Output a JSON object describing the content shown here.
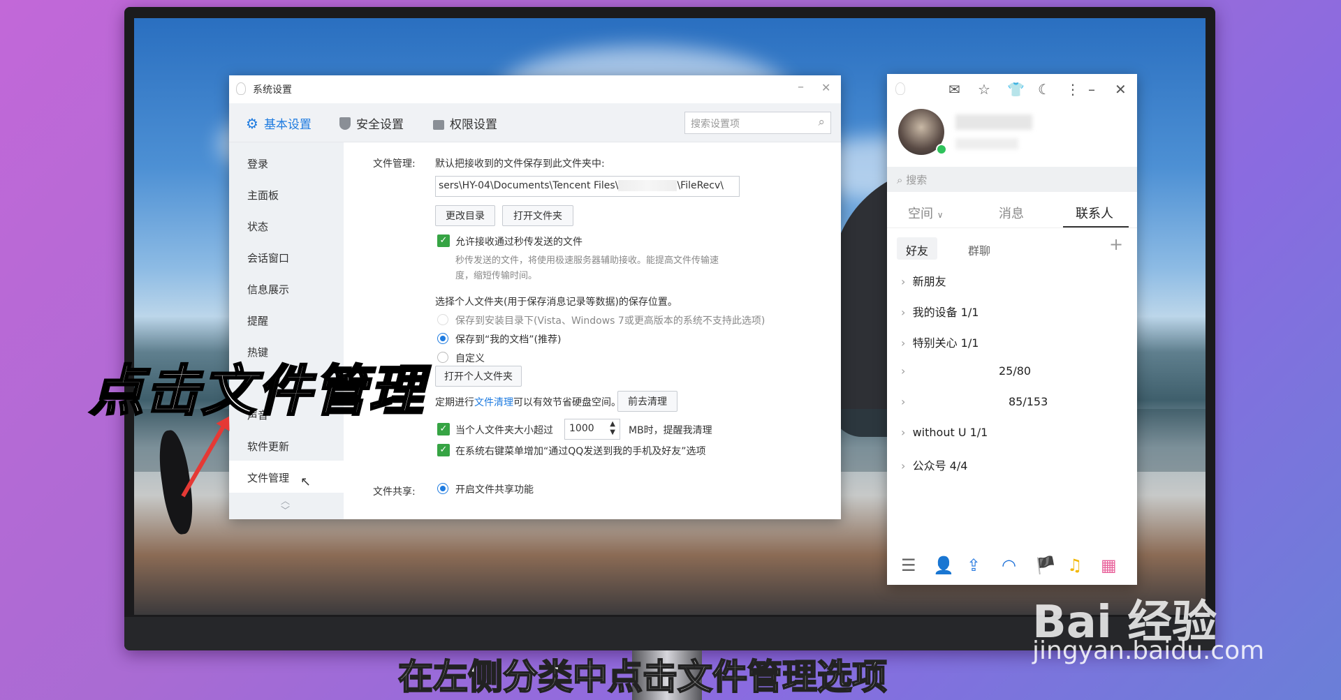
{
  "settings_window": {
    "title": "系统设置",
    "tabs": [
      {
        "label": "基本设置",
        "icon": "gear-icon",
        "active": true
      },
      {
        "label": "安全设置",
        "icon": "shield-icon",
        "active": false
      },
      {
        "label": "权限设置",
        "icon": "lock-icon",
        "active": false
      }
    ],
    "search_placeholder": "搜索设置项",
    "nav_items": [
      "登录",
      "主面板",
      "状态",
      "会话窗口",
      "信息展示",
      "提醒",
      "热键",
      "",
      "声音",
      "软件更新",
      "文件管理"
    ],
    "file_management": {
      "label": "文件管理:",
      "description": "默认把接收到的文件保存到此文件夹中:",
      "path_left": "sers\\HY-04\\Documents\\Tencent Files\\",
      "path_right": "\\FileRecv\\",
      "change_dir_button": "更改目录",
      "open_folder_button": "打开文件夹",
      "allow_quick_send": "允许接收通过秒传发送的文件",
      "quick_send_desc_1": "秒传发送的文件，将使用极速服务器辅助接收。能提高文件传输速",
      "quick_send_desc_2": "度，缩短传输时间。",
      "personal_folder_heading": "选择个人文件夹(用于保存消息记录等数据)的保存位置。",
      "radio_install_dir": "保存到安装目录下(Vista、Windows 7或更高版本的系统不支持此选项)",
      "radio_my_docs": "保存到“我的文档”(推荐)",
      "radio_custom": "自定义",
      "open_personal_folder_button": "打开个人文件夹",
      "cleanup_text_prefix": "定期进行",
      "cleanup_link": "文件清理",
      "cleanup_text_suffix": "可以有效节省硬盘空间。",
      "cleanup_button": "前去清理",
      "size_limit_prefix": "当个人文件夹大小超过",
      "size_limit_value": "1000",
      "size_limit_suffix": "MB时，提醒我清理",
      "context_menu_option": "在系统右键菜单增加“通过QQ发送到我的手机及好友”选项"
    },
    "file_sharing": {
      "label": "文件共享:",
      "enable_sharing": "开启文件共享功能"
    }
  },
  "qq_panel": {
    "search_placeholder": "搜索",
    "tabs": [
      "空间",
      "消息",
      "联系人"
    ],
    "subtabs": [
      "好友",
      "群聊"
    ],
    "groups": [
      "新朋友",
      "我的设备 1/1",
      "特别关心 1/1",
      "25/80",
      "85/153",
      "without U 1/1",
      "公众号 4/4"
    ]
  },
  "overlay": {
    "caption": "点击文件管理",
    "subtitle": "在左侧分类中点击文件管理选项",
    "watermark_main": "Bai 经验",
    "watermark_url": "jingyan.baidu.com"
  },
  "colors": {
    "accent": "#1e7be0",
    "check": "#36a444"
  }
}
